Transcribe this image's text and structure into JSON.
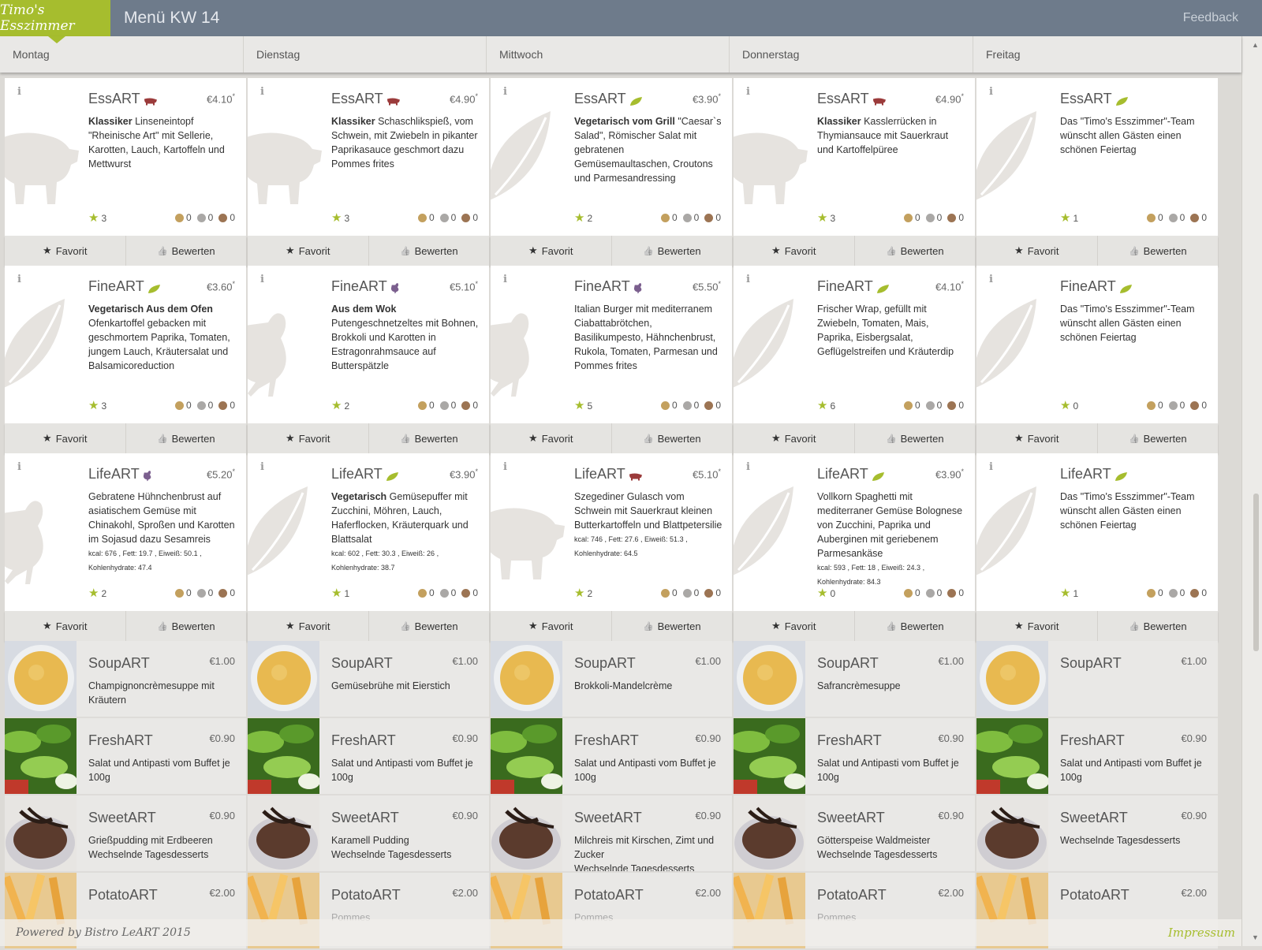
{
  "header": {
    "logo_text": "Timo's Esszimmer",
    "title": "Menü KW 14",
    "feedback": "Feedback"
  },
  "colors": {
    "accent": "#a6bd2e",
    "topbar": "#6e7b8b",
    "gold": "#c3a05e",
    "silver": "#aaa8a6",
    "bronze": "#9c7453"
  },
  "days": [
    "Montag",
    "Dienstag",
    "Mittwoch",
    "Donnerstag",
    "Freitag"
  ],
  "actions": {
    "favorite": "Favorit",
    "rate": "Bewerten"
  },
  "columns": [
    {
      "cards": [
        {
          "title": "EssART",
          "icon": "pig-icon",
          "price": "€4.10",
          "bold": "Klassiker",
          "desc": " Linseneintopf \"Rheinische Art\" mit Sellerie, Karotten, Lauch, Kartoffeln und Mettwurst",
          "nutrition": "",
          "rating": "3",
          "gold": "0",
          "silver": "0",
          "bronze": "0",
          "bg": "pig"
        },
        {
          "title": "FineART",
          "icon": "leaf-icon",
          "price": "€3.60",
          "bold": "Vegetarisch Aus dem Ofen",
          "desc": "Ofenkartoffel gebacken mit geschmortem Paprika, Tomaten, jungem Lauch, Kräutersalat und Balsamicoreduction",
          "nutrition": "",
          "rating": "3",
          "gold": "0",
          "silver": "0",
          "bronze": "0",
          "bg": "leaf",
          "boldblock": true
        },
        {
          "title": "LifeART",
          "icon": "chicken-icon",
          "price": "€5.20",
          "bold": "",
          "desc": "Gebratene Hühnchenbrust auf asiatischem Gemüse mit Chinakohl, Sproßen und Karotten im Sojasud dazu Sesamreis",
          "nutrition": "kcal: 676 , Fett: 19.7 , Eiweiß: 50.1 , Kohlenhydrate: 47.4",
          "rating": "2",
          "gold": "0",
          "silver": "0",
          "bronze": "0",
          "bg": "chicken"
        }
      ],
      "sides": [
        {
          "title": "SoupART",
          "price": "€1.00",
          "desc": "Champignoncrèmesuppe mit Kräutern",
          "img": "soup"
        },
        {
          "title": "FreshART",
          "price": "€0.90",
          "desc": "Salat und Antipasti vom Buffet je 100g",
          "img": "salad"
        },
        {
          "title": "SweetART",
          "price": "€0.90",
          "desc": "Grießpudding mit Erdbeeren\nWechselnde Tagesdesserts",
          "img": "dessert"
        },
        {
          "title": "PotatoART",
          "price": "€2.00",
          "desc": "",
          "img": "fries"
        }
      ]
    },
    {
      "cards": [
        {
          "title": "EssART",
          "icon": "pig-icon",
          "price": "€4.90",
          "bold": "Klassiker",
          "desc": " Schaschlikspieß, vom Schwein, mit Zwiebeln in pikanter Paprikasauce geschmort dazu Pommes frites",
          "nutrition": "",
          "rating": "3",
          "gold": "0",
          "silver": "0",
          "bronze": "0",
          "bg": "pig"
        },
        {
          "title": "FineART",
          "icon": "chicken-icon",
          "price": "€5.10",
          "bold": "Aus dem Wok",
          "desc": "Putengeschnetzeltes mit Bohnen, Brokkoli und Karotten in Estragonrahmsauce auf Butterspätzle",
          "nutrition": "",
          "rating": "2",
          "gold": "0",
          "silver": "0",
          "bronze": "0",
          "bg": "chicken",
          "boldblock": true
        },
        {
          "title": "LifeART",
          "icon": "leaf-icon",
          "price": "€3.90",
          "bold": "Vegetarisch",
          "desc": " Gemüsepuffer mit Zucchini, Möhren, Lauch, Haferflocken, Kräuterquark und Blattsalat",
          "nutrition": "kcal: 602 , Fett: 30.3 , Eiweiß: 26 , Kohlenhydrate: 38.7",
          "rating": "1",
          "gold": "0",
          "silver": "0",
          "bronze": "0",
          "bg": "leaf"
        }
      ],
      "sides": [
        {
          "title": "SoupART",
          "price": "€1.00",
          "desc": "Gemüsebrühe mit Eierstich",
          "img": "soup"
        },
        {
          "title": "FreshART",
          "price": "€0.90",
          "desc": "Salat und Antipasti vom Buffet je 100g",
          "img": "salad"
        },
        {
          "title": "SweetART",
          "price": "€0.90",
          "desc": "Karamell Pudding\nWechselnde Tagesdesserts",
          "img": "dessert"
        },
        {
          "title": "PotatoART",
          "price": "€2.00",
          "desc": "Pommes",
          "img": "fries"
        }
      ]
    },
    {
      "cards": [
        {
          "title": "EssART",
          "icon": "leaf-icon",
          "price": "€3.90",
          "bold": "Vegetarisch vom Grill",
          "desc": " \"Caesar`s Salad\", Römischer Salat mit gebratenen Gemüsemaultaschen, Croutons und Parmesandressing",
          "nutrition": "",
          "rating": "2",
          "gold": "0",
          "silver": "0",
          "bronze": "0",
          "bg": "leaf"
        },
        {
          "title": "FineART",
          "icon": "chicken-icon",
          "price": "€5.50",
          "bold": "",
          "desc": "Italian Burger mit mediterranem Ciabattabrötchen, Basilikumpesto, Hähnchenbrust, Rukola, Tomaten, Parmesan und Pommes frites",
          "nutrition": "",
          "rating": "5",
          "gold": "0",
          "silver": "0",
          "bronze": "0",
          "bg": "chicken"
        },
        {
          "title": "LifeART",
          "icon": "pig-icon",
          "price": "€5.10",
          "bold": "",
          "desc": "Szegediner Gulasch vom Schwein mit Sauerkraut kleinen Butterkartoffeln und Blattpetersilie",
          "nutrition": "kcal: 746 , Fett: 27.6 , Eiweiß: 51.3 , Kohlenhydrate: 64.5",
          "rating": "2",
          "gold": "0",
          "silver": "0",
          "bronze": "0",
          "bg": "pig"
        }
      ],
      "sides": [
        {
          "title": "SoupART",
          "price": "€1.00",
          "desc": "Brokkoli-Mandelcrème",
          "img": "soup"
        },
        {
          "title": "FreshART",
          "price": "€0.90",
          "desc": "Salat und Antipasti vom Buffet je 100g",
          "img": "salad"
        },
        {
          "title": "SweetART",
          "price": "€0.90",
          "desc": "Milchreis mit Kirschen, Zimt und Zucker\nWechselnde Tagesdesserts",
          "img": "dessert"
        },
        {
          "title": "PotatoART",
          "price": "€2.00",
          "desc": "Pommes",
          "img": "fries"
        }
      ]
    },
    {
      "cards": [
        {
          "title": "EssART",
          "icon": "pig-icon",
          "price": "€4.90",
          "bold": "Klassiker",
          "desc": " Kasslerrücken in Thymiansauce mit Sauerkraut und Kartoffelpüree",
          "nutrition": "",
          "rating": "3",
          "gold": "0",
          "silver": "0",
          "bronze": "0",
          "bg": "pig"
        },
        {
          "title": "FineART",
          "icon": "leaf-icon",
          "price": "€4.10",
          "bold": "",
          "desc": "Frischer Wrap, gefüllt mit Zwiebeln, Tomaten, Mais, Paprika, Eisbergsalat, Geflügelstreifen und Kräuterdip",
          "nutrition": "",
          "rating": "6",
          "gold": "0",
          "silver": "0",
          "bronze": "0",
          "bg": "leaf"
        },
        {
          "title": "LifeART",
          "icon": "leaf-icon",
          "price": "€3.90",
          "bold": "",
          "desc": "Vollkorn Spaghetti mit mediterraner Gemüse Bolognese von Zucchini, Paprika und Auberginen mit geriebenem Parmesankäse",
          "nutrition": "kcal: 593 , Fett: 18 , Eiweiß: 24.3 , Kohlenhydrate: 84.3",
          "rating": "0",
          "gold": "0",
          "silver": "0",
          "bronze": "0",
          "bg": "leaf"
        }
      ],
      "sides": [
        {
          "title": "SoupART",
          "price": "€1.00",
          "desc": "Safrancrèmesuppe",
          "img": "soup"
        },
        {
          "title": "FreshART",
          "price": "€0.90",
          "desc": "Salat und Antipasti vom Buffet je 100g",
          "img": "salad"
        },
        {
          "title": "SweetART",
          "price": "€0.90",
          "desc": "Götterspeise Waldmeister\nWechselnde Tagesdesserts",
          "img": "dessert"
        },
        {
          "title": "PotatoART",
          "price": "€2.00",
          "desc": "Pommes",
          "img": "fries"
        }
      ]
    },
    {
      "cards": [
        {
          "title": "EssART",
          "icon": "leaf-icon",
          "price": "",
          "bold": "",
          "desc": "Das \"Timo's Esszimmer\"-Team wünscht allen Gästen einen schönen Feiertag",
          "nutrition": "",
          "rating": "1",
          "gold": "0",
          "silver": "0",
          "bronze": "0",
          "bg": "leaf"
        },
        {
          "title": "FineART",
          "icon": "leaf-icon",
          "price": "",
          "bold": "",
          "desc": "Das \"Timo's Esszimmer\"-Team wünscht allen Gästen einen schönen Feiertag",
          "nutrition": "",
          "rating": "0",
          "gold": "0",
          "silver": "0",
          "bronze": "0",
          "bg": "leaf"
        },
        {
          "title": "LifeART",
          "icon": "leaf-icon",
          "price": "",
          "bold": "",
          "desc": "Das \"Timo's Esszimmer\"-Team wünscht allen Gästen einen schönen Feiertag",
          "nutrition": "",
          "rating": "1",
          "gold": "0",
          "silver": "0",
          "bronze": "0",
          "bg": "leaf"
        }
      ],
      "sides": [
        {
          "title": "SoupART",
          "price": "€1.00",
          "desc": "",
          "img": "soup"
        },
        {
          "title": "FreshART",
          "price": "€0.90",
          "desc": "Salat und Antipasti vom Buffet je 100g",
          "img": "salad"
        },
        {
          "title": "SweetART",
          "price": "€0.90",
          "desc": "Wechselnde Tagesdesserts",
          "img": "dessert"
        },
        {
          "title": "PotatoART",
          "price": "€2.00",
          "desc": "",
          "img": "fries"
        }
      ]
    }
  ],
  "footer": {
    "powered": "Powered by Bistro LeART 2015",
    "impressum": "Impressum"
  }
}
